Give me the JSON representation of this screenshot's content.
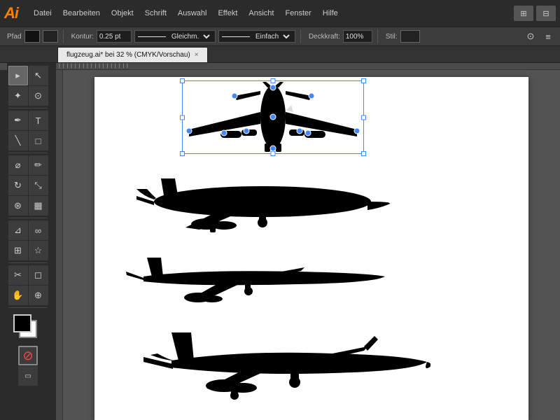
{
  "app": {
    "logo": "Ai",
    "menu_items": [
      "Datei",
      "Bearbeiten",
      "Objekt",
      "Schrift",
      "Auswahl",
      "Effekt",
      "Ansicht",
      "Fenster",
      "Hilfe"
    ]
  },
  "toolbar": {
    "pfad_label": "Pfad",
    "kontur_label": "Kontur:",
    "kontur_value": "0.25 pt",
    "stroke_type1": "Gleichm.",
    "stroke_type2": "Einfach",
    "deckkraft_label": "Deckkraft:",
    "deckkraft_value": "100%",
    "stil_label": "Stil:"
  },
  "tab": {
    "title": "flugzeug.ai* bei 32 % (CMYK/Vorschau)",
    "close": "×"
  },
  "tools": [
    {
      "name": "selection",
      "icon": "▸",
      "active": true
    },
    {
      "name": "direct-selection",
      "icon": "↖"
    },
    {
      "name": "magic-wand",
      "icon": "✦"
    },
    {
      "name": "lasso",
      "icon": "⊙"
    },
    {
      "name": "pen",
      "icon": "✒"
    },
    {
      "name": "text",
      "icon": "T"
    },
    {
      "name": "line",
      "icon": "╲"
    },
    {
      "name": "rect",
      "icon": "□"
    },
    {
      "name": "paintbrush",
      "icon": "⌀"
    },
    {
      "name": "pencil",
      "icon": "✏"
    },
    {
      "name": "rotate",
      "icon": "↻"
    },
    {
      "name": "scale",
      "icon": "⤡"
    },
    {
      "name": "warp",
      "icon": "⊛"
    },
    {
      "name": "gradient",
      "icon": "▦"
    },
    {
      "name": "eyedropper",
      "icon": "⊿"
    },
    {
      "name": "blend",
      "icon": "∞"
    },
    {
      "name": "scissors",
      "icon": "✂"
    },
    {
      "name": "hand",
      "icon": "✋"
    },
    {
      "name": "zoom",
      "icon": "⊕"
    }
  ]
}
